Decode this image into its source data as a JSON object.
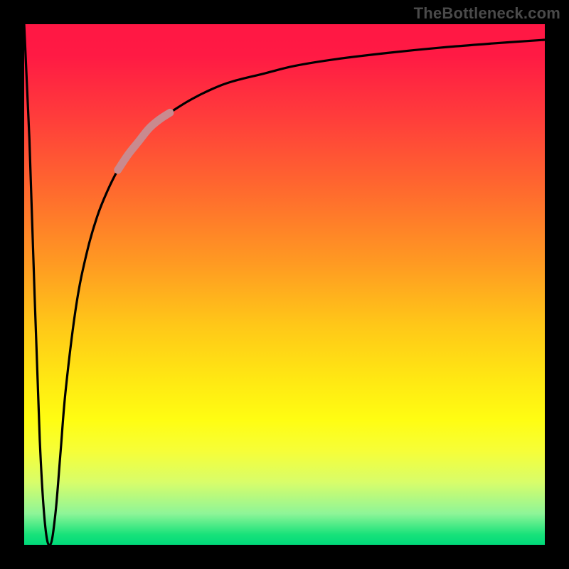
{
  "watermark": "TheBottleneck.com",
  "colors": {
    "frame": "#000000",
    "curve": "#000000",
    "highlight": "#c98a8f",
    "gradient_top": "#ff1744",
    "gradient_mid": "#fffd12",
    "gradient_bottom": "#00d97a"
  },
  "chart_data": {
    "type": "line",
    "title": "",
    "xlabel": "",
    "ylabel": "",
    "xlim": [
      0,
      100
    ],
    "ylim": [
      0,
      100
    ],
    "grid": false,
    "notes": "V-shaped bottleneck curve. y-axis inverted visually (0 at bottom = good / green, 100 at top = bad / red). Sharp drop from x≈0 to a minimum near x≈5, then steep asymptotic rise toward ~97 as x→100.",
    "series": [
      {
        "name": "bottleneck-curve",
        "x": [
          0,
          1,
          2,
          3,
          4,
          5,
          6,
          7,
          8,
          10,
          12,
          14,
          16,
          18,
          20,
          24,
          28,
          32,
          36,
          40,
          46,
          52,
          60,
          70,
          80,
          90,
          100
        ],
        "values": [
          100,
          78,
          48,
          20,
          4,
          0,
          6,
          18,
          30,
          46,
          56,
          63,
          68,
          72,
          75,
          80,
          83,
          85.5,
          87.5,
          89,
          90.5,
          92,
          93.3,
          94.5,
          95.5,
          96.3,
          97
        ]
      },
      {
        "name": "highlight-segment",
        "x": [
          18,
          20,
          22,
          24,
          26,
          28
        ],
        "values": [
          72,
          75,
          77.5,
          80,
          81.7,
          83
        ]
      }
    ]
  }
}
